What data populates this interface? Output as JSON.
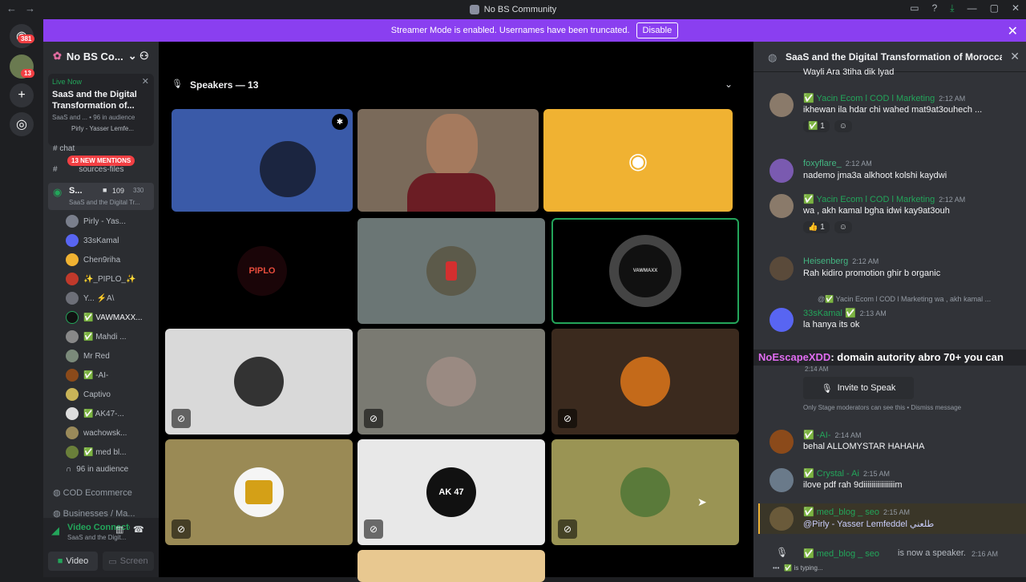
{
  "window": {
    "title": "No BS Community",
    "back": "←",
    "forward": "→"
  },
  "banner": {
    "text": "Streamer Mode is enabled. Usernames have been truncated.",
    "button": "Disable"
  },
  "rail": {
    "dm_badge": "381",
    "server_badge": "13"
  },
  "server": {
    "name": "No BS Co...",
    "live_label": "Live Now",
    "stage_title": "SaaS and the Digital Transformation of...",
    "stage_sub": "SaaS and ... • 96 in audience",
    "stage_host": "Pirly - Yasser Lemfe...",
    "mentions": "13 NEW MENTIONS"
  },
  "channels": [
    {
      "name": "chat"
    },
    {
      "name": "sources-files"
    }
  ],
  "active_stage": {
    "name": "S...",
    "count": "109",
    "count2": "330",
    "topic": "SaaS and the Digital Tr..."
  },
  "members": [
    "Pirly - Yas...",
    "33sKamal",
    "Chen9riha",
    "✨_PIPLO_✨",
    "Y... ⚡A\\",
    "✅ VAWMAXX...",
    "✅ Mahdi ...",
    "Mr Red",
    "✅ -AI-",
    "Captivo",
    "✅ AK47-...",
    "wachowsk...",
    "✅ med bl..."
  ],
  "audience": "96 in audience",
  "categories": [
    "COD Ecommerce",
    "Businesses / Ma..."
  ],
  "voice": {
    "status": "Video Connected",
    "sub": "SaaS and the Digit...",
    "video_btn": "Video",
    "screen_btn": "Screen"
  },
  "stage": {
    "speakers_label": "Speakers — 13",
    "tiles": [
      "PIPLO",
      "VAWMAXX",
      "AK 47"
    ]
  },
  "chat": {
    "title": "SaaS and the Digital Transformation of Moroccan In",
    "top_text": "Wayli Ara 3tiha dik lyad",
    "messages": [
      {
        "name": "✅ Yacin Ecom l COD l Marketing",
        "time": "2:12 AM",
        "text": "ikhewan ila hdar chi wahed mat9at3ouhech ...",
        "reaction": "✅ 1"
      },
      {
        "name": "foxyflare_",
        "time": "2:12 AM",
        "text": "nademo jma3a alkhoot kolshi kaydwi"
      },
      {
        "name": "✅ Yacin Ecom l COD l Marketing",
        "time": "2:12 AM",
        "text": "wa , akh kamal bgha idwi kay9at3ouh",
        "reaction": "👍 1"
      },
      {
        "name": "Heisenberg",
        "time": "2:12 AM",
        "text": "Rah kidiro promotion ghir b organic"
      },
      {
        "name": "33sKamal ✅",
        "time": "2:13 AM",
        "text": "la hanya its ok",
        "reply": "@✅ Yacin Ecom l COD l Marketing wa , akh kamal ..."
      },
      {
        "name": "✅ -AI-",
        "time": "2:14 AM",
        "text": "behal ALLOMYSTAR HAHAHA"
      },
      {
        "name": "✅ Crystal - Ai",
        "time": "2:15 AM",
        "text": "ilove pdf rah 9diiiiiiiiiiiiiiiim"
      },
      {
        "name": "✅ med_blog _ seo",
        "time": "2:15 AM",
        "text": "@Pirly - Yasser Lemfeddel طلعني"
      },
      {
        "name": "✅ med_blog _ seo",
        "time": "2:16 AM",
        "text": "is now a speaker."
      }
    ],
    "overlay": {
      "name": "NoEscapeXDD",
      "text": ": domain autority abro 70+ you can"
    },
    "system": {
      "time": "2:14 AM",
      "invite_btn": "Invite to Speak",
      "note": "Only Stage moderators can see this • Dismiss message"
    },
    "typing": "is typing..."
  }
}
